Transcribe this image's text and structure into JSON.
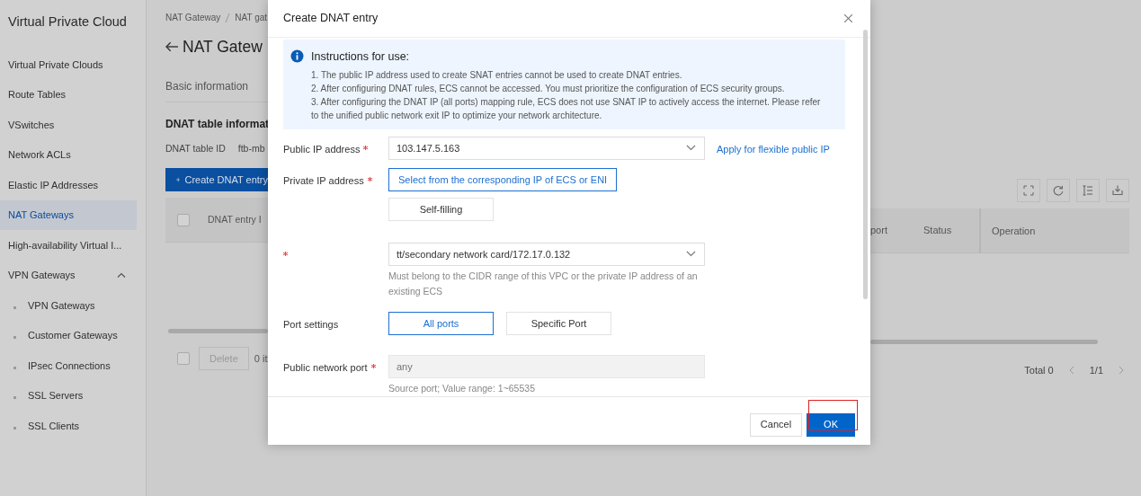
{
  "sidebar": {
    "title": "Virtual Private Cloud",
    "items": [
      {
        "label": "Virtual Private Clouds",
        "selected": false
      },
      {
        "label": "Route Tables",
        "selected": false
      },
      {
        "label": "VSwitches",
        "selected": false
      },
      {
        "label": "Network ACLs",
        "selected": false
      },
      {
        "label": "Elastic IP Addresses",
        "selected": false
      },
      {
        "label": "NAT Gateways",
        "selected": true
      },
      {
        "label": "High-availability Virtual I...",
        "selected": false
      },
      {
        "label": "VPN Gateways",
        "selected": false,
        "expanded": true,
        "children": [
          {
            "label": "VPN Gateways",
            "selected": false
          },
          {
            "label": "Customer Gateways",
            "selected": false
          },
          {
            "label": "IPsec Connections",
            "selected": false
          },
          {
            "label": "SSL Servers",
            "selected": false
          },
          {
            "label": "SSL Clients",
            "selected": false
          }
        ]
      }
    ]
  },
  "page": {
    "breadcrumb": [
      "NAT Gateway",
      "NAT gat"
    ],
    "title": "NAT Gatew",
    "tab": "Basic information",
    "section_title": "DNAT table informat",
    "id_label": "DNAT table ID",
    "id_value": "ftb-mb",
    "create_button": "Create DNAT entry",
    "table": {
      "header_checkbox": {
        "checked": false
      },
      "columns_left": [
        "DNAT entry I"
      ],
      "columns_right": [
        "port",
        "Status",
        "Operation"
      ],
      "footer_left": {
        "checkbox": {
          "checked": false
        },
        "delete": "Delete",
        "count": "0 it"
      },
      "total": "Total 0",
      "page": "1/1"
    }
  },
  "modal": {
    "title": "Create DNAT entry",
    "notice": {
      "title": "Instructions for use:",
      "lines": [
        "1. The public IP address used to create SNAT entries cannot be used to create DNAT entries.",
        "2. After configuring DNAT rules, ECS cannot be accessed. You must prioritize the configuration of ECS security groups.",
        "3. After configuring the DNAT IP (all ports) mapping rule, ECS does not use SNAT IP to actively access the internet. Please refer to the unified public network exit IP to optimize your network architecture."
      ]
    },
    "fields": [
      {
        "kind": "select",
        "label": "Public IP address",
        "required": true,
        "value": "103.147.5.163",
        "link": "Apply for flexible public IP"
      },
      {
        "kind": "choice",
        "label": "Private IP address",
        "required": true,
        "options": [
          {
            "label": "Select from the corresponding IP of ECS or ENI",
            "selected": true
          },
          {
            "label": "Self-filling",
            "selected": false
          }
        ]
      },
      {
        "kind": "select",
        "required": true,
        "value": "tt/secondary network card/172.17.0.132",
        "help": "Must belong to the CIDR range of this VPC or the private IP address of an existing ECS"
      },
      {
        "kind": "choice",
        "label": "Port settings",
        "required": false,
        "options": [
          {
            "label": "All ports",
            "selected": true
          },
          {
            "label": "Specific Port",
            "selected": false
          }
        ]
      },
      {
        "kind": "input",
        "label": "Public network port",
        "required": true,
        "placeholder": "any",
        "disabled": true,
        "help": "Source port; Value range: 1~65535"
      }
    ],
    "buttons": [
      {
        "label": "Cancel",
        "kind": "secondary",
        "highlighted": false
      },
      {
        "label": "OK",
        "kind": "primary",
        "highlighted": true
      }
    ]
  }
}
